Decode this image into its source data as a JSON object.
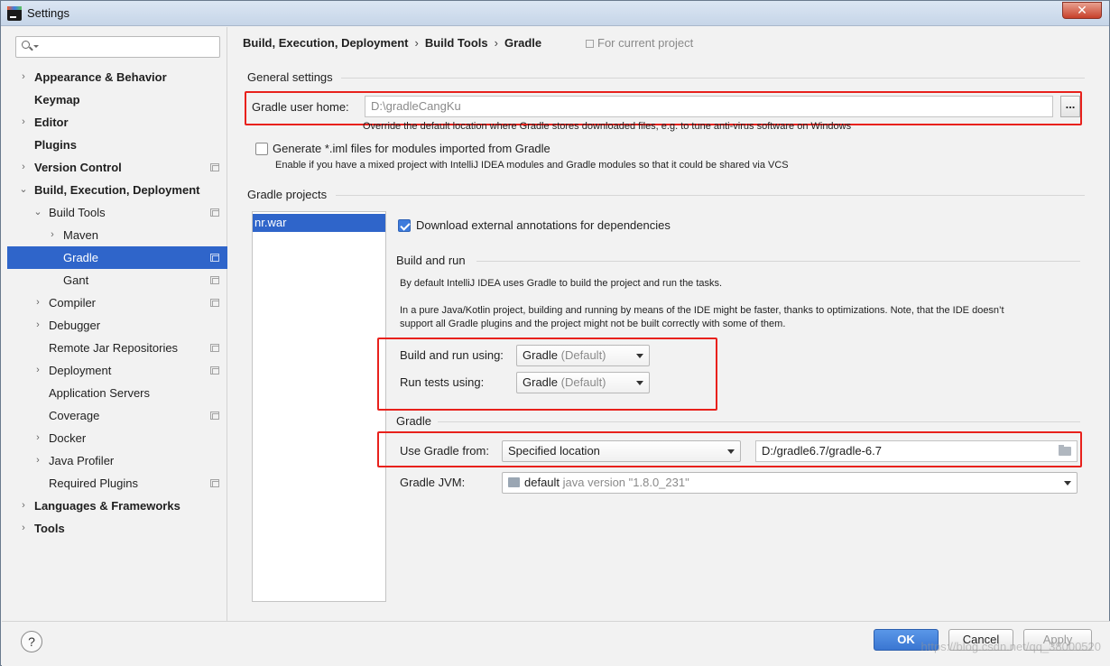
{
  "window": {
    "title": "Settings",
    "close_glyph": "✕"
  },
  "search": {
    "placeholder": ""
  },
  "sidebar": {
    "items": [
      {
        "label": "Appearance & Behavior",
        "arrow": "›"
      },
      {
        "label": "Keymap",
        "arrow": ""
      },
      {
        "label": "Editor",
        "arrow": "›"
      },
      {
        "label": "Plugins",
        "arrow": ""
      },
      {
        "label": "Version Control",
        "arrow": "›"
      },
      {
        "label": "Build, Execution, Deployment",
        "arrow": "⌄"
      },
      {
        "label": "Build Tools",
        "arrow": "⌄"
      },
      {
        "label": "Maven",
        "arrow": "›"
      },
      {
        "label": "Gradle",
        "arrow": ""
      },
      {
        "label": "Gant",
        "arrow": ""
      },
      {
        "label": "Compiler",
        "arrow": "›"
      },
      {
        "label": "Debugger",
        "arrow": "›"
      },
      {
        "label": "Remote Jar Repositories",
        "arrow": ""
      },
      {
        "label": "Deployment",
        "arrow": "›"
      },
      {
        "label": "Application Servers",
        "arrow": ""
      },
      {
        "label": "Coverage",
        "arrow": ""
      },
      {
        "label": "Docker",
        "arrow": "›"
      },
      {
        "label": "Java Profiler",
        "arrow": "›"
      },
      {
        "label": "Required Plugins",
        "arrow": ""
      },
      {
        "label": "Languages & Frameworks",
        "arrow": "›"
      },
      {
        "label": "Tools",
        "arrow": "›"
      }
    ]
  },
  "breadcrumb": {
    "items": [
      "Build, Execution, Deployment",
      "Build Tools",
      "Gradle"
    ],
    "separator": "›",
    "scope": "For current project"
  },
  "general": {
    "section_title": "General settings",
    "user_home_label": "Gradle user home:",
    "user_home_value": "D:\\gradleCangKu",
    "browse_label": "...",
    "user_home_hint": "Override the default location where Gradle stores downloaded files, e.g. to tune anti-virus software on Windows",
    "iml_label": "Generate *.iml files for modules imported from Gradle",
    "iml_checked": false,
    "iml_hint": "Enable if you have a mixed project with IntelliJ IDEA modules and Gradle modules so that it could be shared via VCS"
  },
  "projects": {
    "section_title": "Gradle projects",
    "list": [
      "nr.war"
    ],
    "download_annotations_label": "Download external annotations for dependencies",
    "download_annotations_checked": true
  },
  "build_run": {
    "section_title": "Build and run",
    "info1": "By default IntelliJ IDEA uses Gradle to build the project and run the tasks.",
    "info2_line1": "In a pure Java/Kotlin project, building and running by means of the IDE might be faster, thanks to optimizations. Note, that the IDE doesn’t",
    "info2_line2": "support all Gradle plugins and the project might not be built correctly with some of them.",
    "build_using_label": "Build and run using:",
    "build_using_value": "Gradle",
    "build_using_hint": "(Default)",
    "tests_using_label": "Run tests using:",
    "tests_using_value": "Gradle",
    "tests_using_hint": "(Default)"
  },
  "gradle": {
    "section_title": "Gradle",
    "use_from_label": "Use Gradle from:",
    "use_from_value": "Specified location",
    "location_value": "D:/gradle6.7/gradle-6.7",
    "jvm_label": "Gradle JVM:",
    "jvm_value": "default",
    "jvm_version": "java version \"1.8.0_231\""
  },
  "footer": {
    "help_label": "?",
    "ok_label": "OK",
    "cancel_label": "Cancel",
    "apply_label": "Apply",
    "watermark": "https://blog.csdn.net/qq_38000520"
  },
  "colors": {
    "selection": "#2f65ca",
    "highlight_box": "#e8211c",
    "ok_button": "#3a76d2"
  }
}
